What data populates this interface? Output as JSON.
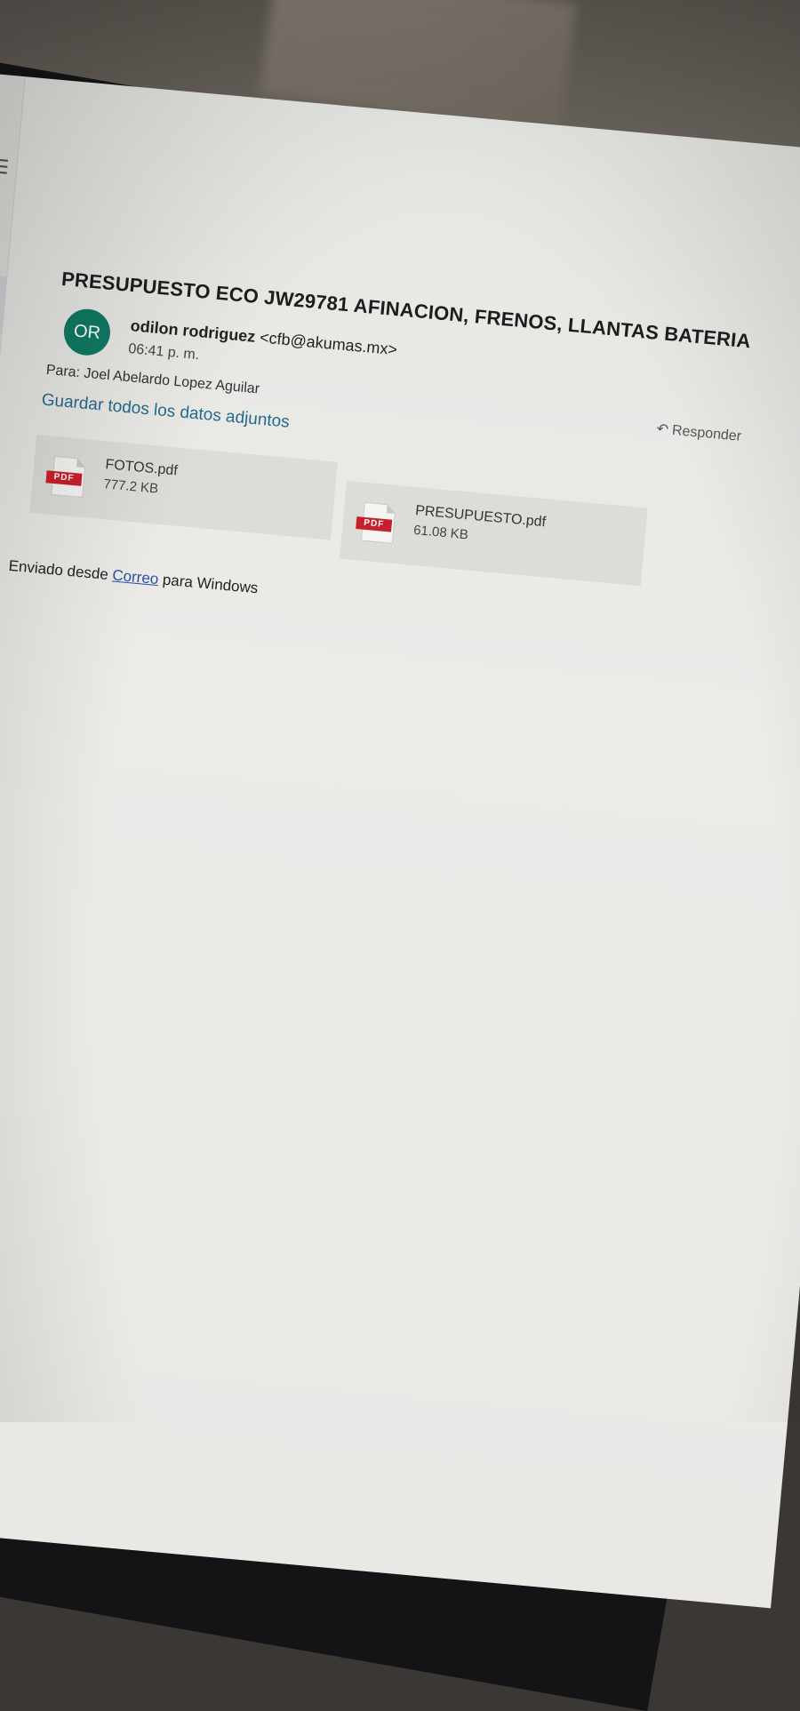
{
  "email": {
    "subject": "PRESUPUESTO ECO JW29781 AFINACION, FRENOS, LLANTAS BATERIA",
    "avatar_initials": "OR",
    "sender_name": "odilon rodriguez",
    "sender_address": "<cfb@akumas.mx>",
    "time": "06:41 p. m.",
    "to": "Para: Joel Abelardo Lopez Aguilar",
    "reply_label": "Responder",
    "reply_icon": "reply-icon",
    "save_all_label": "Guardar todos los datos adjuntos",
    "attachments": [
      {
        "icon": "pdf-icon",
        "badge": "PDF",
        "name": "FOTOS.pdf",
        "size": "777.2 KB"
      },
      {
        "icon": "pdf-icon",
        "badge": "PDF",
        "name": "PRESUPUESTO.pdf",
        "size": "61.08 KB"
      }
    ],
    "signature": {
      "prefix": "Enviado desde",
      "link": "Correo",
      "suffix": "para Windows"
    }
  },
  "nav": {
    "icons": [
      "menu-icon",
      "checkmark-icon"
    ]
  },
  "colors": {
    "avatar": "#0f7a63",
    "link": "#246a8e",
    "pdf_badge": "#c8202a"
  }
}
